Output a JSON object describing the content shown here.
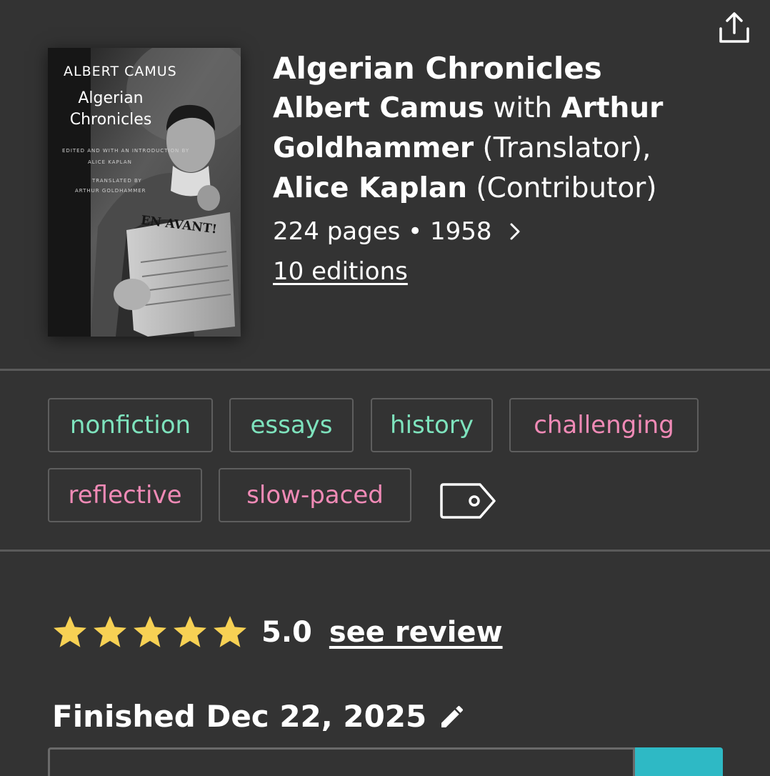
{
  "book": {
    "title": "Algerian Chronicles",
    "authors": {
      "author1": "Albert Camus",
      "with_text": " with ",
      "author2": "Arthur Goldhammer",
      "role2": " (Translator), ",
      "author3": "Alice Kaplan",
      "role3": " (Contributor)"
    },
    "meta": "224 pages • 1958",
    "editions": "10 editions",
    "cover": {
      "author": "ALBERT CAMUS",
      "title_line1": "Algerian",
      "title_line2": "Chronicles",
      "edited_line": "EDITED AND WITH AN INTRODUCTION BY",
      "editor": "ALICE KAPLAN",
      "translated_line": "TRANSLATED BY",
      "translator": "ARTHUR GOLDHAMMER",
      "newspaper": "EN AVANT!"
    }
  },
  "tags": [
    {
      "label": "nonfiction",
      "color": "green"
    },
    {
      "label": "essays",
      "color": "green"
    },
    {
      "label": "history",
      "color": "green"
    },
    {
      "label": "challenging",
      "color": "pink"
    },
    {
      "label": "reflective",
      "color": "pink"
    },
    {
      "label": "slow-paced",
      "color": "pink"
    }
  ],
  "rating": {
    "stars": 5,
    "value": "5.0",
    "see_review": "see review"
  },
  "finished": "Finished Dec 22, 2025",
  "icons": {
    "share": "share-icon",
    "chevron": "chevron-right-icon",
    "tag_add": "tag-icon",
    "pencil": "pencil-icon",
    "star": "star-icon"
  },
  "colors": {
    "background": "#333333",
    "tag_green": "#7ee3bd",
    "tag_pink": "#f08ab6",
    "star": "#f7d154",
    "accent": "#2eb9c5"
  }
}
